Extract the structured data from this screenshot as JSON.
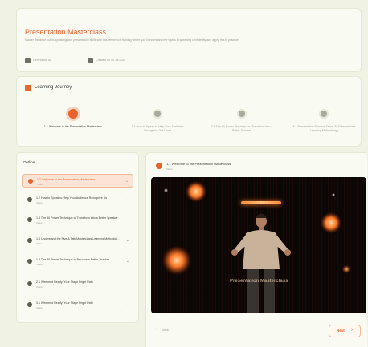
{
  "course": {
    "title": "Presentation Masterclass",
    "description": "Master the art of public speaking and presentation skills with this immersive training where you'll understand the topics in speaking confidently and apply this in practice",
    "meta": [
      {
        "icon": "document-icon",
        "text": "Generation ID"
      },
      {
        "icon": "calendar-icon",
        "text": "Created on 05 Jul 2025"
      }
    ]
  },
  "journey": {
    "title": "Learning Journey",
    "steps": [
      {
        "label": "1.1 Welcome to the Presentation Masterclass",
        "active": true
      },
      {
        "label": "2.1 How to Speak to Help Your Audience Recognize Our Level",
        "active": false
      },
      {
        "label": "3.1 The 80 Power Technique to Transform into a Better Speaker",
        "active": false
      },
      {
        "label": "4.1 Presentation Practice Tasks: Full Masterclass Learning Methodology",
        "active": false
      }
    ]
  },
  "outline": {
    "title": "Outline",
    "items": [
      {
        "title": "1.1 Welcome to the Presentation Masterclass",
        "sub": "Video",
        "active": true
      },
      {
        "title": "1.2 How to Speak to Help Your Audience Recognize Us",
        "sub": "Video",
        "active": false
      },
      {
        "title": "1.3 The 80 Power Technique to Transform into a Better Speaker",
        "sub": "Video",
        "active": false
      },
      {
        "title": "1.4 Understand the Five & Talk Masterclass Learning Methodology",
        "sub": "Video",
        "active": false
      },
      {
        "title": "1.5 The 80 Power Technique to Become a Better Teacher",
        "sub": "Video",
        "active": false
      },
      {
        "title": "2.1 Weekend Ready: Your Stage Fright Path",
        "sub": "Video",
        "active": false
      },
      {
        "title": "3.1 Weekend Ready: Your Stage Fright Path",
        "sub": "Video",
        "active": false
      }
    ]
  },
  "player": {
    "title": "1.1 Welcome to the Presentation Masterclass",
    "subtitle": "Video",
    "caption_text": "Presentation Masterclass"
  },
  "nav": {
    "back_label": "Back",
    "next_label": "Next"
  },
  "colors": {
    "accent": "#e8632c",
    "background": "#f0f2e3",
    "video_bg": "#0c0605"
  }
}
